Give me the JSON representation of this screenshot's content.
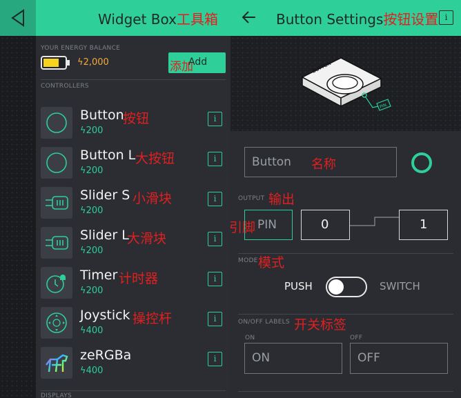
{
  "colors": {
    "accent": "#2ecf98",
    "panel": "#2b2d32",
    "energy": "#f4a93c",
    "annotation": "#e02020"
  },
  "left": {
    "title": "Widget Box",
    "title_annotation": "工具箱",
    "balance_label": "YOUR ENERGY BALANCE",
    "balance_value": "2,000",
    "add_label": "Add",
    "add_annotation": "添加",
    "controllers_label": "CONTROLLERS",
    "displays_label": "DISPLAYS",
    "widgets": [
      {
        "name": "Button",
        "annotation": "按钮",
        "price": "200",
        "icon": "circle-icon"
      },
      {
        "name": "Button L",
        "annotation": "大按钮",
        "price": "200",
        "icon": "circle-icon"
      },
      {
        "name": "Slider S",
        "annotation": "小滑块",
        "price": "200",
        "icon": "slider-icon"
      },
      {
        "name": "Slider L",
        "annotation": "大滑块",
        "price": "200",
        "icon": "slider-icon"
      },
      {
        "name": "Timer",
        "annotation": "计时器",
        "price": "200",
        "icon": "timer-icon"
      },
      {
        "name": "Joystick",
        "annotation": "操控杆",
        "price": "400",
        "icon": "joystick-icon"
      },
      {
        "name": "zeRGBa",
        "annotation": "",
        "price": "400",
        "icon": "zebra-icon"
      }
    ]
  },
  "right": {
    "title": "Button Settings",
    "title_annotation": "按钮设置",
    "illustration_label": "BUTTON",
    "illustration_pin": "PIN",
    "name_placeholder": "Button",
    "name_annotation": "名称",
    "output_label": "OUTPUT",
    "output_annotation": "输出",
    "pin_label": "PIN",
    "pin_annotation": "引脚",
    "low_value": "0",
    "high_value": "1",
    "mode_label": "MODE",
    "mode_annotation": "模式",
    "mode_push": "PUSH",
    "mode_switch": "SWITCH",
    "mode_is_switch": false,
    "onoff_label": "ON/OFF LABELS",
    "onoff_annotation": "开关标签",
    "on_caption": "ON",
    "off_caption": "OFF",
    "on_placeholder": "ON",
    "off_placeholder": "OFF"
  }
}
